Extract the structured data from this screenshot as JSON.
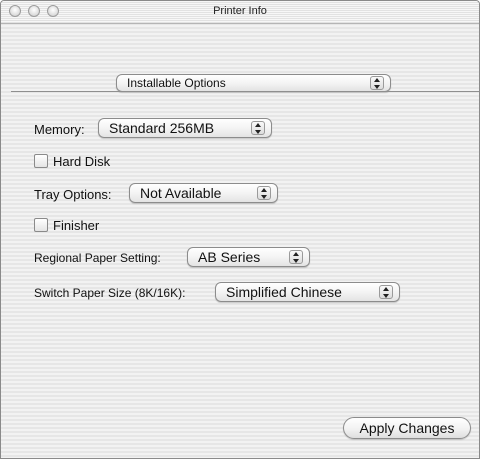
{
  "window": {
    "title": "Printer Info"
  },
  "section_popup": {
    "value": "Installable Options"
  },
  "memory": {
    "label": "Memory:",
    "value": "Standard 256MB"
  },
  "hard_disk": {
    "label": "Hard Disk",
    "checked": false
  },
  "tray_options": {
    "label": "Tray Options:",
    "value": "Not Available"
  },
  "finisher": {
    "label": "Finisher",
    "checked": false
  },
  "regional_paper": {
    "label": "Regional Paper Setting:",
    "value": "AB Series"
  },
  "switch_paper": {
    "label": "Switch Paper Size (8K/16K):",
    "value": "Simplified Chinese"
  },
  "apply_button": {
    "label": "Apply Changes"
  },
  "icons": {
    "close": "traffic-light-close",
    "minimize": "traffic-light-minimize",
    "zoom": "traffic-light-zoom",
    "popup_arrows": "up-down-arrows"
  }
}
